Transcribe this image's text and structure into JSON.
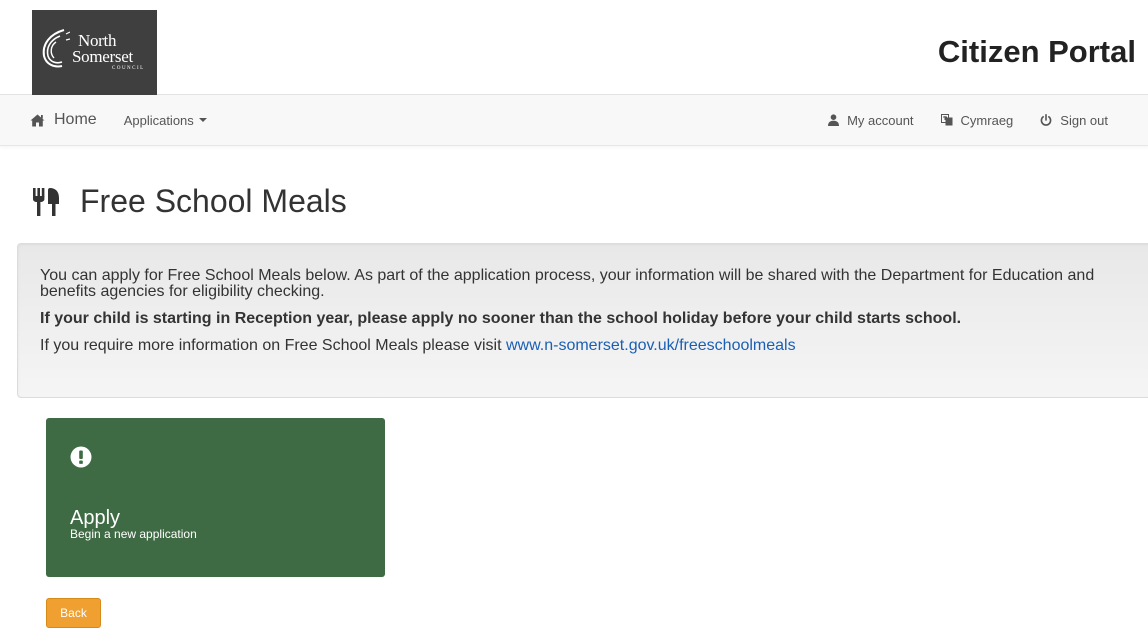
{
  "header": {
    "logo": {
      "line1": "North",
      "line2": "Somerset",
      "line3": "COUNCIL"
    },
    "portal_title": "Citizen Portal"
  },
  "navbar": {
    "home_label": "Home",
    "applications_label": "Applications",
    "my_account_label": "My account",
    "language_label": "Cymraeg",
    "sign_out_label": "Sign out"
  },
  "page": {
    "title": "Free School Meals",
    "info": {
      "paragraph1": "You can apply for Free School Meals below. As part of the application process, your information will be shared with the Department for Education and benefits agencies for eligibility checking.",
      "paragraph2": "If your child is starting in Reception year, please apply no sooner than the school holiday before your child starts school.",
      "paragraph3_prefix": "If you require more information on Free School Meals please visit ",
      "link_text": "www.n-somerset.gov.uk/freeschoolmeals"
    },
    "apply_tile": {
      "title": "Apply",
      "description": "Begin a new application"
    },
    "back_label": "Back"
  },
  "colors": {
    "apply_tile_bg": "#3e6b43",
    "back_button_bg": "#f0a030",
    "link": "#1a5fb4",
    "logo_bg": "#3f3f3f"
  },
  "icons": {
    "home": "home-icon",
    "account": "user-icon",
    "language": "language-icon",
    "sign_out": "power-icon",
    "meals": "cutlery-icon",
    "apply": "exclamation-circle-icon"
  }
}
